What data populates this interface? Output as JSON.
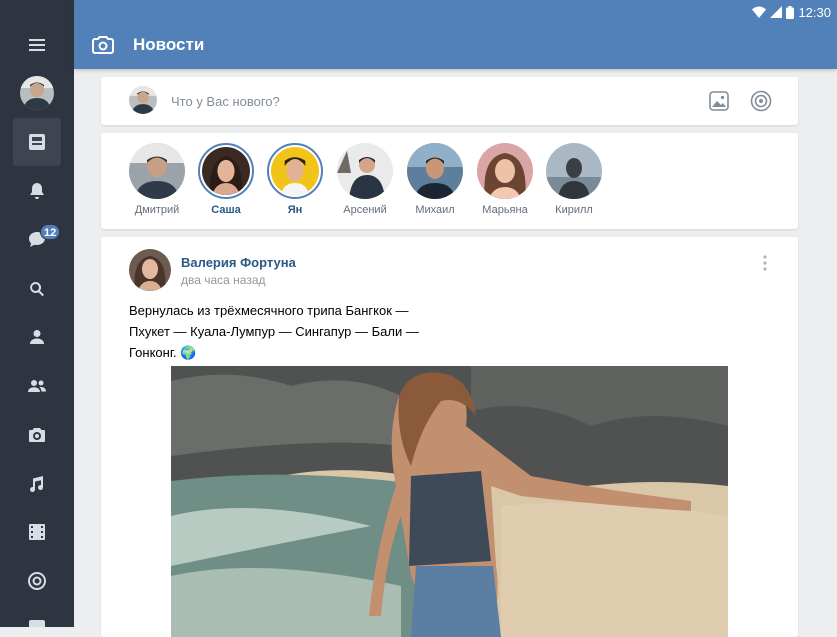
{
  "status_bar": {
    "time": "12:30"
  },
  "header": {
    "title": "Новости"
  },
  "sidebar": {
    "messages_badge": "12",
    "items": [
      {
        "icon": "menu-icon"
      },
      {
        "icon": "avatar"
      },
      {
        "icon": "news-icon",
        "active": true
      },
      {
        "icon": "bell-icon"
      },
      {
        "icon": "messages-icon"
      },
      {
        "icon": "search-icon"
      },
      {
        "icon": "user-icon"
      },
      {
        "icon": "friends-icon"
      },
      {
        "icon": "camera-icon"
      },
      {
        "icon": "music-icon"
      },
      {
        "icon": "video-icon"
      },
      {
        "icon": "target-icon"
      }
    ]
  },
  "composer": {
    "placeholder": "Что у Вас нового?"
  },
  "stories": [
    {
      "name": "Дмитрий",
      "bold": false
    },
    {
      "name": "Саша",
      "bold": true
    },
    {
      "name": "Ян",
      "bold": true
    },
    {
      "name": "Арсений",
      "bold": false
    },
    {
      "name": "Михаил",
      "bold": false
    },
    {
      "name": "Марьяна",
      "bold": false
    },
    {
      "name": "Кирилл",
      "bold": false
    }
  ],
  "post": {
    "author": "Валерия Фортуна",
    "time": "два часа назад",
    "text": "Вернулась из трёхмесячного трипа Бангкок — Пхукет — Куала-Лумпур — Сингапур — Бали — Гонконг. 🌍"
  },
  "colors": {
    "accent": "#5181b8",
    "sidebar": "#2f3540",
    "background": "#edeef0",
    "link": "#2a5885"
  }
}
